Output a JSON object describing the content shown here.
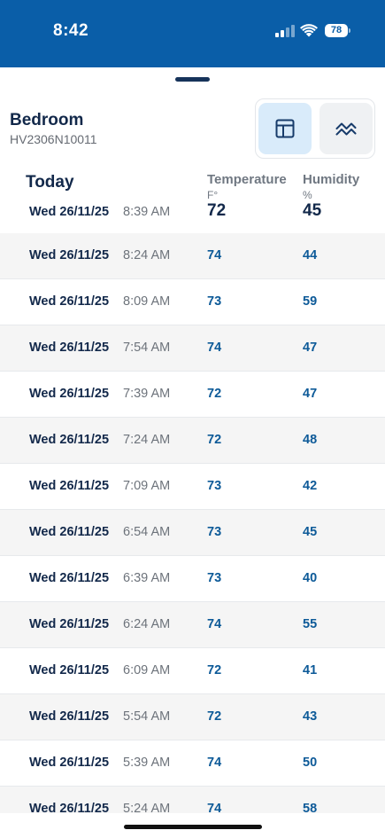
{
  "status_bar": {
    "time": "8:42",
    "battery": "78",
    "background": "#0a5ea8"
  },
  "device": {
    "name": "Bedroom",
    "serial": "HV2306N10011"
  },
  "view_switch": {
    "table_icon": "table-icon",
    "chart_icon": "chart-line-icon"
  },
  "table": {
    "section_label": "Today",
    "columns": [
      {
        "title": "Temperature",
        "unit": "F°"
      },
      {
        "title": "Humidity",
        "unit": "%"
      }
    ],
    "current": {
      "date": "Wed 26/11/25",
      "time": "8:39 AM",
      "temperature": "72",
      "humidity": "45"
    },
    "rows": [
      {
        "date": "Wed 26/11/25",
        "time": "8:24 AM",
        "temperature": "74",
        "humidity": "44"
      },
      {
        "date": "Wed 26/11/25",
        "time": "8:09 AM",
        "temperature": "73",
        "humidity": "59"
      },
      {
        "date": "Wed 26/11/25",
        "time": "7:54 AM",
        "temperature": "74",
        "humidity": "47"
      },
      {
        "date": "Wed 26/11/25",
        "time": "7:39 AM",
        "temperature": "72",
        "humidity": "47"
      },
      {
        "date": "Wed 26/11/25",
        "time": "7:24 AM",
        "temperature": "72",
        "humidity": "48"
      },
      {
        "date": "Wed 26/11/25",
        "time": "7:09 AM",
        "temperature": "73",
        "humidity": "42"
      },
      {
        "date": "Wed 26/11/25",
        "time": "6:54 AM",
        "temperature": "73",
        "humidity": "45"
      },
      {
        "date": "Wed 26/11/25",
        "time": "6:39 AM",
        "temperature": "73",
        "humidity": "40"
      },
      {
        "date": "Wed 26/11/25",
        "time": "6:24 AM",
        "temperature": "74",
        "humidity": "55"
      },
      {
        "date": "Wed 26/11/25",
        "time": "6:09 AM",
        "temperature": "72",
        "humidity": "41"
      },
      {
        "date": "Wed 26/11/25",
        "time": "5:54 AM",
        "temperature": "72",
        "humidity": "43"
      },
      {
        "date": "Wed 26/11/25",
        "time": "5:39 AM",
        "temperature": "74",
        "humidity": "50"
      },
      {
        "date": "Wed 26/11/25",
        "time": "5:24 AM",
        "temperature": "74",
        "humidity": "58"
      }
    ]
  }
}
